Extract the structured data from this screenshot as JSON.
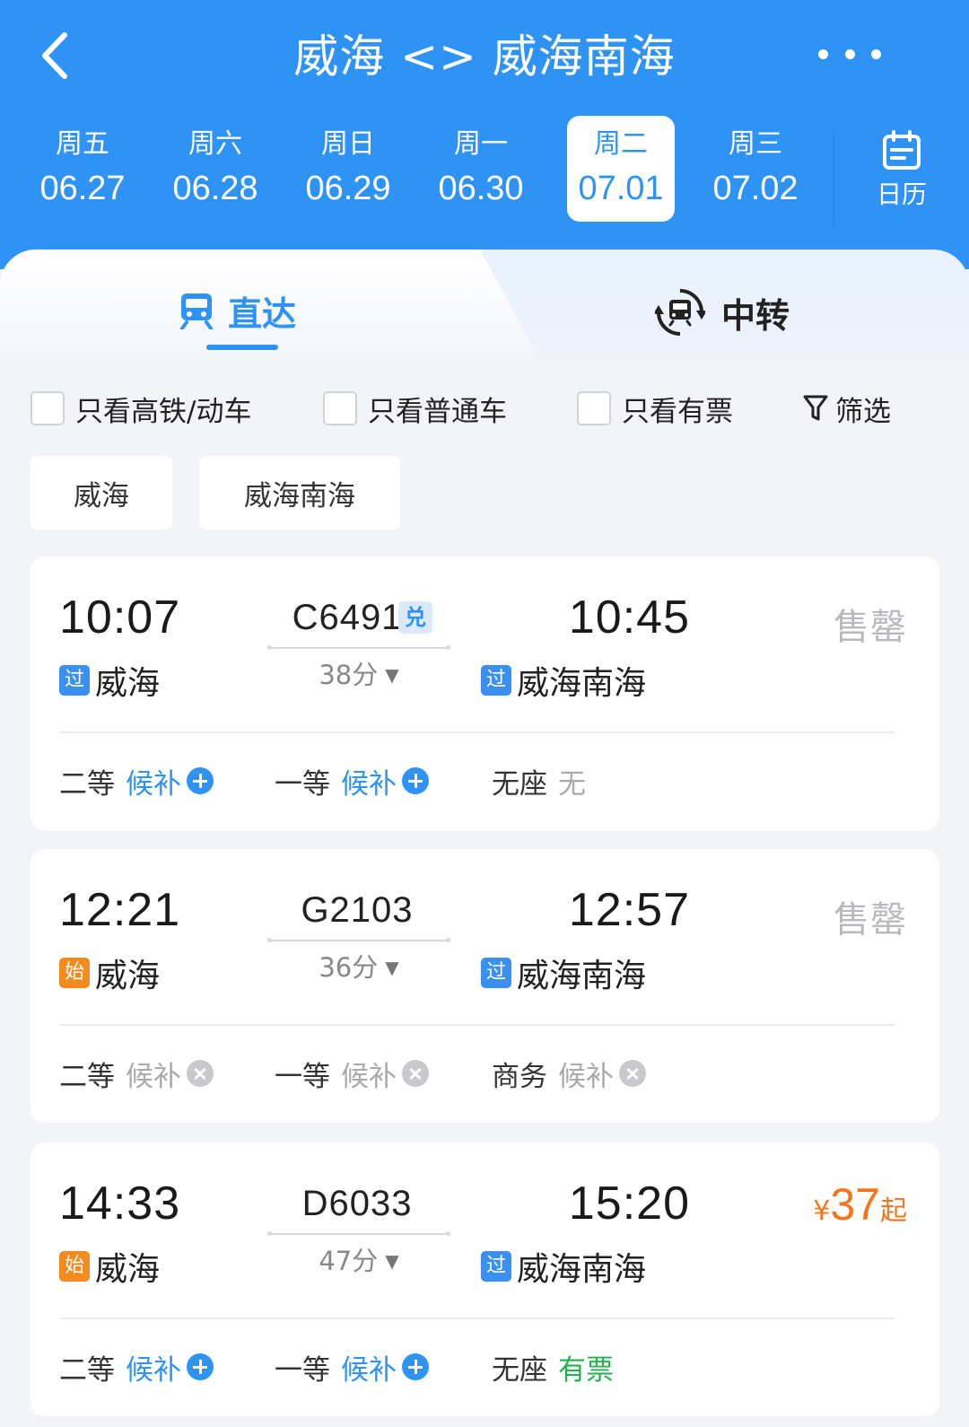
{
  "header": {
    "title": "威海 <> 威海南海",
    "back_icon": "chevron-left-icon",
    "more_icon": "more-horizontal-icon"
  },
  "dates": [
    {
      "weekday": "周五",
      "date": "06.27",
      "active": false
    },
    {
      "weekday": "周六",
      "date": "06.28",
      "active": false
    },
    {
      "weekday": "周日",
      "date": "06.29",
      "active": false
    },
    {
      "weekday": "周一",
      "date": "06.30",
      "active": false
    },
    {
      "weekday": "周二",
      "date": "07.01",
      "active": true
    },
    {
      "weekday": "周三",
      "date": "07.02",
      "active": false
    }
  ],
  "calendar": {
    "label": "日历",
    "icon": "calendar-icon"
  },
  "tabs": {
    "direct": {
      "label": "直达",
      "icon": "train-icon",
      "active": true
    },
    "transfer": {
      "label": "中转",
      "icon": "transfer-train-icon",
      "active": false
    }
  },
  "filters": {
    "hsr_only": "只看高铁/动车",
    "normal_only": "只看普通车",
    "available_only": "只看有票",
    "filter_label": "筛选",
    "filter_icon": "funnel-icon"
  },
  "stations": [
    "威海",
    "威海南海"
  ],
  "trains": [
    {
      "dep_time": "10:07",
      "train_no": "C6491",
      "exchange_badge": "兑",
      "arr_time": "10:45",
      "duration": "38分",
      "dep_badge": "过",
      "dep_station": "威海",
      "arr_badge": "过",
      "arr_station": "威海南海",
      "status": "售罄",
      "seats": [
        {
          "cls": "二等",
          "value": "候补"
        },
        {
          "cls": "一等",
          "value": "候补"
        },
        {
          "cls": "无座",
          "value": "无"
        }
      ]
    },
    {
      "dep_time": "12:21",
      "train_no": "G2103",
      "arr_time": "12:57",
      "duration": "36分",
      "dep_badge": "始",
      "dep_station": "威海",
      "arr_badge": "过",
      "arr_station": "威海南海",
      "status": "售罄",
      "seats": [
        {
          "cls": "二等",
          "value": "候补"
        },
        {
          "cls": "一等",
          "value": "候补"
        },
        {
          "cls": "商务",
          "value": "候补"
        }
      ]
    },
    {
      "dep_time": "14:33",
      "train_no": "D6033",
      "arr_time": "15:20",
      "duration": "47分",
      "dep_badge": "始",
      "dep_station": "威海",
      "arr_badge": "过",
      "arr_station": "威海南海",
      "price": {
        "currency": "¥",
        "amount": "37",
        "suffix": "起"
      },
      "seats": [
        {
          "cls": "二等",
          "value": "候补"
        },
        {
          "cls": "一等",
          "value": "候补"
        },
        {
          "cls": "无座",
          "value": "有票"
        }
      ]
    }
  ],
  "colors": {
    "brand_blue": "#2e93f5",
    "price_orange": "#f5751e",
    "available_green": "#23b14d",
    "sold_out_gray": "#b7b9bd"
  }
}
